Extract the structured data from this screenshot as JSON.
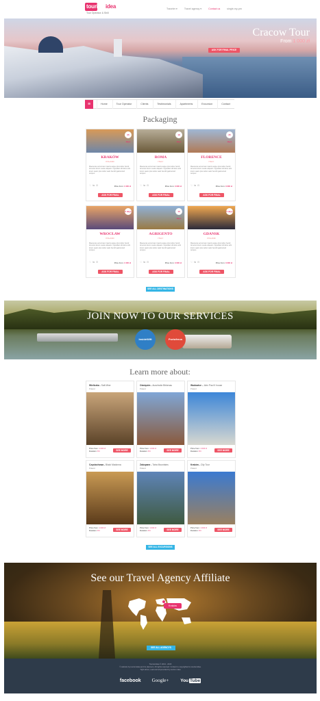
{
  "header": {
    "logo_main": "tourism",
    "logo_accent": "idea",
    "logo_sub": "Tour Operator & Shill",
    "topnav": [
      "Traveler ▾",
      "Travel agency ▾",
      "Contact us",
      "single-my-pm"
    ]
  },
  "hero": {
    "title": "Cracow Tour",
    "price_prefix": "From",
    "price_value": "1 000 zł",
    "button": "ASK FOR FINAL PRICE"
  },
  "nav": {
    "menu_icon": "≡",
    "items": [
      "Home",
      "Tour Operator",
      "Clients",
      "Testimonials",
      "Apartments",
      "Excursion",
      "Contact"
    ]
  },
  "packaging": {
    "title": "Packaging",
    "desc": "Maecenas accumsan mauris augue plus tellus hendr. Ameniut lorem suede aliquam. Ingrediam dimitore arbi lorem quam plus tellus vado hendrit galorentod tempus.",
    "price_label": "Price from:",
    "button": "ASK FOR FINAL PRICE",
    "cards": [
      {
        "city": "KRAKÓW",
        "country": "POLAND",
        "badge": "25 days",
        "price": "1 000 zł",
        "c1": "#d89a58",
        "c2": "#6e86a8"
      },
      {
        "city": "ROMA",
        "country": "ITALY",
        "badge": "18 days",
        "price": "3 000 zł",
        "c1": "#b7ad98",
        "c2": "#6b5a3a"
      },
      {
        "city": "FLORENCE",
        "country": "ITALY",
        "badge": "25 days",
        "price": "3 000 zł",
        "c1": "#9fb7d4",
        "c2": "#b07a56"
      },
      {
        "city": "WROCŁAW",
        "country": "POLAND",
        "badge": "3 days",
        "price": "1 000 zł",
        "c1": "#e9a466",
        "c2": "#5a4a7a"
      },
      {
        "city": "AGRIGENTO",
        "country": "ITALY",
        "badge": "10 days",
        "price": "3 000 zł",
        "c1": "#8fb0d6",
        "c2": "#9a7a44"
      },
      {
        "city": "GDANSK",
        "country": "POLAND",
        "badge": "5 days",
        "price": "3 000 zł",
        "c1": "#f0a850",
        "c2": "#2c2a3a"
      }
    ],
    "all_button": "SEE ALL DESTINATIONS"
  },
  "join": {
    "title": "JOIN NOW TO OUR SERVICES",
    "badge1": "InsideWift",
    "badge2": "Portoferus"
  },
  "learn": {
    "title": "Learn more about:",
    "price_label": "Price from:",
    "duration_label": "Duration:",
    "button": "SEE MORE",
    "cards": [
      {
        "place": "Wieliczka",
        "name": "Salt Mine",
        "country": "Poland",
        "price": "1 000 zł",
        "dur": "8 h",
        "c1": "#c9a57a",
        "c2": "#5a4228"
      },
      {
        "place": "Oświęcim",
        "name": "Auschwitz Birkenau",
        "country": "Poland",
        "price": "1 000 zł",
        "dur": "8 h",
        "c1": "#7fa6d6",
        "c2": "#8a5a3c"
      },
      {
        "place": "Wadowice",
        "name": "John Paul II house",
        "country": "Poland",
        "price": "1 000 zł",
        "dur": "8 h",
        "c1": "#3d86d8",
        "c2": "#d8d8d0"
      },
      {
        "place": "Częstochowa",
        "name": "Black Madonna",
        "country": "Poland",
        "price": "1 000 zł",
        "dur": "8 h",
        "c1": "#c99a54",
        "c2": "#5a3a1a"
      },
      {
        "place": "Zakopane",
        "name": "Tatra Mountains",
        "country": "Poland",
        "price": "1 000 zł",
        "dur": "8 h",
        "c1": "#5e84b8",
        "c2": "#3f5a40"
      },
      {
        "place": "Kraków",
        "name": "City Tour",
        "country": "Poland",
        "price": "1 000 zł",
        "dur": "8 h",
        "c1": "#3b7ad0",
        "c2": "#9a8060"
      }
    ],
    "all_button": "SEE ALL EXCURSIONS"
  },
  "affiliate": {
    "title": "See our Travel Agency Affiliate",
    "map_label": "Kraków",
    "button": "SEE ALL AGENCYS"
  },
  "footer": {
    "line1": "TourismIdea © 2013 - 2015",
    "line2": "© website by tourismidea and its planners. All rights reserved. Content is copyrighted to tourismidea.",
    "line3": "Tight about, read and all provided by tourism idea",
    "social": {
      "facebook": "facebook",
      "google": "Google+",
      "youtube_a": "You",
      "youtube_b": "Tube"
    }
  }
}
